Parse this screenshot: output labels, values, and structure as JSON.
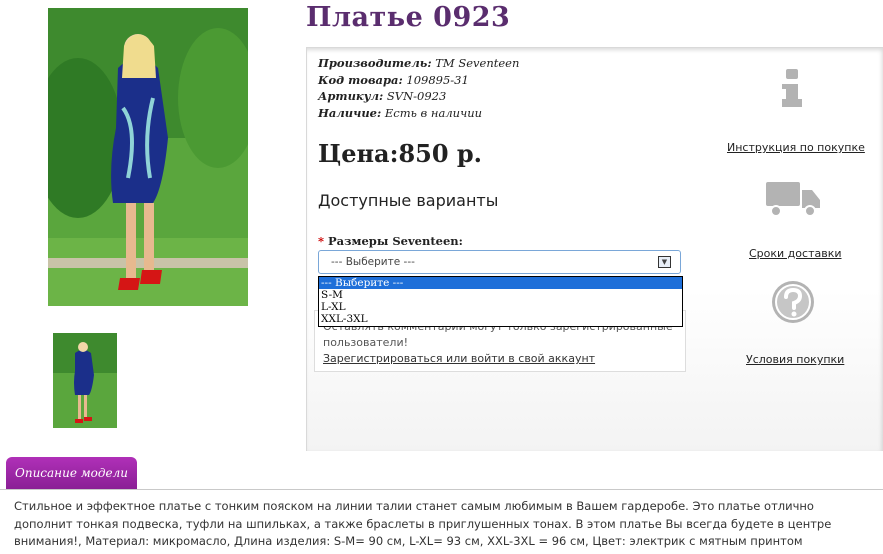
{
  "product": {
    "title": "Платье 0923",
    "info": [
      {
        "label": "Производитель:",
        "value": " TM Seventeen"
      },
      {
        "label": "Код товара:",
        "value": " 109895-31"
      },
      {
        "label": "Артикул:",
        "value": " SVN-0923"
      },
      {
        "label": "Наличие:",
        "value": " Есть в наличии"
      }
    ],
    "price": "Цена:850 р.",
    "variants_heading": "Доступные варианты",
    "size_label_required": "*",
    "size_label": "Размеры Seventeen:",
    "select_value": "--- Выберите ---",
    "select_arrow": "▼",
    "options": [
      "--- Выберите ---",
      "S-M",
      "L-XL",
      "XXL-3XL"
    ],
    "note_line1": "Оставлять комментарии могут только зарегистрированные",
    "note_line2": "пользователи!",
    "note_link": "Зарегистрироваться или войти в свой аккаунт"
  },
  "sidebar_links": {
    "purchase_instructions": "Инструкция по покупке",
    "delivery_terms": "Сроки доставки",
    "purchase_conditions": "Условия покупки"
  },
  "tabs": {
    "description": "Описание модели"
  },
  "description": "Стильное и эффектное платье с тонким пояском на линии талии станет самым любимым в Вашем гардеробе. Это платье отлично дополнит тонкая подвеска, туфли на шпильках, а также браслеты в приглушенных тонах. В этом платье Вы всегда будете в центре внимания!, Материал: микромасло, Длина изделия: S-M= 90 см, L-XL= 93 см, XXL-3XL = 96 см, Цвет: электрик с мятным принтом",
  "colors": {
    "title": "#5a2d6e",
    "tab": "#9b27a6",
    "select_highlight": "#1e6fd9"
  }
}
